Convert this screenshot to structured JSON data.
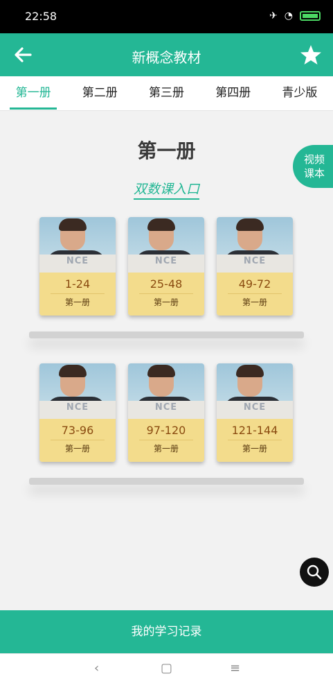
{
  "status_bar": {
    "time": "22:58"
  },
  "app_bar": {
    "title": "新概念教材"
  },
  "tabs": [
    {
      "label": "第一册"
    },
    {
      "label": "第二册"
    },
    {
      "label": "第三册"
    },
    {
      "label": "第四册"
    },
    {
      "label": "青少版"
    }
  ],
  "main": {
    "book_title": "第一册",
    "entry_link": "双数课入口",
    "video_button": {
      "line1": "视频",
      "line2": "课本"
    }
  },
  "books": [
    {
      "cover_text": "NCE",
      "range": "1-24",
      "subtitle": "第一册"
    },
    {
      "cover_text": "NCE",
      "range": "25-48",
      "subtitle": "第一册"
    },
    {
      "cover_text": "NCE",
      "range": "49-72",
      "subtitle": "第一册"
    },
    {
      "cover_text": "NCE",
      "range": "73-96",
      "subtitle": "第一册"
    },
    {
      "cover_text": "NCE",
      "range": "97-120",
      "subtitle": "第一册"
    },
    {
      "cover_text": "NCE",
      "range": "121-144",
      "subtitle": "第一册"
    }
  ],
  "bottom_bar": {
    "label": "我的学习记录"
  },
  "colors": {
    "accent": "#24b795",
    "book_label": "#f3dc8c"
  },
  "icons": {
    "back": "arrow-left-icon",
    "favorite": "star-icon",
    "search": "search-icon"
  }
}
